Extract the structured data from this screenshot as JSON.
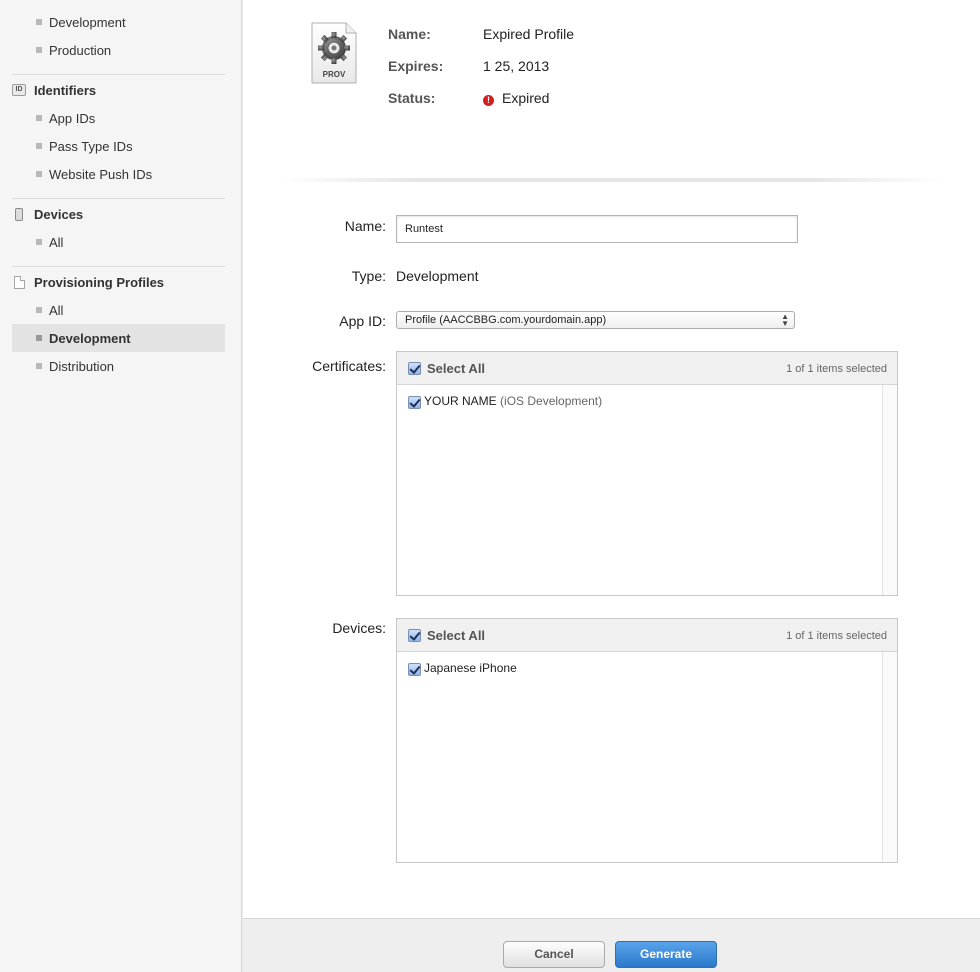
{
  "sidebar": {
    "certificates": {
      "items": [
        {
          "label": "Development"
        },
        {
          "label": "Production"
        }
      ]
    },
    "identifiers": {
      "title": "Identifiers",
      "badge": "ID",
      "items": [
        {
          "label": "App IDs"
        },
        {
          "label": "Pass Type IDs"
        },
        {
          "label": "Website Push IDs"
        }
      ]
    },
    "devices": {
      "title": "Devices",
      "items": [
        {
          "label": "All"
        }
      ]
    },
    "profiles": {
      "title": "Provisioning Profiles",
      "items": [
        {
          "label": "All"
        },
        {
          "label": "Development",
          "active": true
        },
        {
          "label": "Distribution"
        }
      ]
    }
  },
  "profile_summary": {
    "icon_label": "PROV",
    "name_label": "Name:",
    "name_value": "Expired Profile",
    "expires_label": "Expires:",
    "expires_value": "1 25, 2013",
    "status_label": "Status:",
    "status_value": "Expired",
    "status_icon": "!",
    "status_color": "#d51d1d"
  },
  "form": {
    "name_label": "Name:",
    "name_value": "Runtest",
    "type_label": "Type:",
    "type_value": "Development",
    "appid_label": "App ID:",
    "appid_value": "Profile (AACCBBG.com.yourdomain.app)",
    "certificates": {
      "label": "Certificates:",
      "select_all": "Select All",
      "count": "1 of 1 items selected",
      "items": [
        {
          "name": "YOUR NAME",
          "detail": "(iOS Development)",
          "checked": true
        }
      ]
    },
    "devices": {
      "label": "Devices:",
      "select_all": "Select All",
      "count": "1 of 1 items selected",
      "items": [
        {
          "name": "Japanese iPhone",
          "checked": true
        }
      ]
    }
  },
  "footer": {
    "cancel_label": "Cancel",
    "generate_label": "Generate",
    "generate_color": "#2a79cc"
  }
}
